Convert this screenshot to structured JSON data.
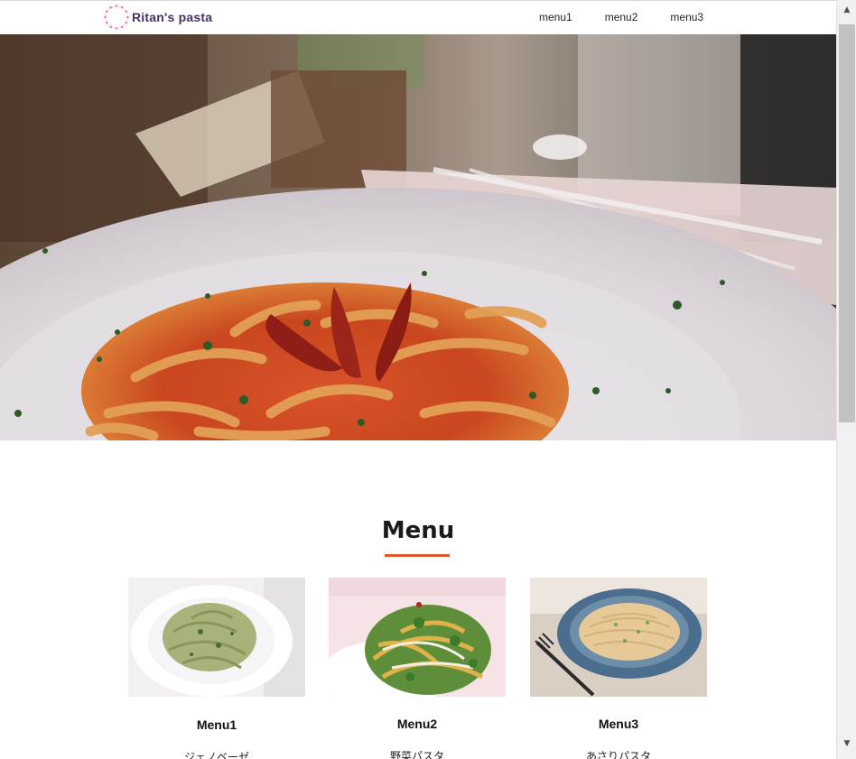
{
  "header": {
    "logo_text": "Ritan's pasta",
    "nav": [
      "menu1",
      "menu2",
      "menu3"
    ]
  },
  "menu_section": {
    "heading": "Menu",
    "accent_color": "#e2562b",
    "cards": [
      {
        "title": "Menu1",
        "description": "ジェノベーゼ"
      },
      {
        "title": "Menu2",
        "description": "野菜パスタ"
      },
      {
        "title": "Menu3",
        "description": "あさりパスタ"
      }
    ]
  },
  "colors": {
    "logo_text": "#4a2f6f",
    "logo_dots": "#e07ab0"
  },
  "icons": {
    "logo": "dotted-circle-logo-icon",
    "scroll_up": "triangle-up-icon",
    "scroll_down": "triangle-down-icon"
  }
}
